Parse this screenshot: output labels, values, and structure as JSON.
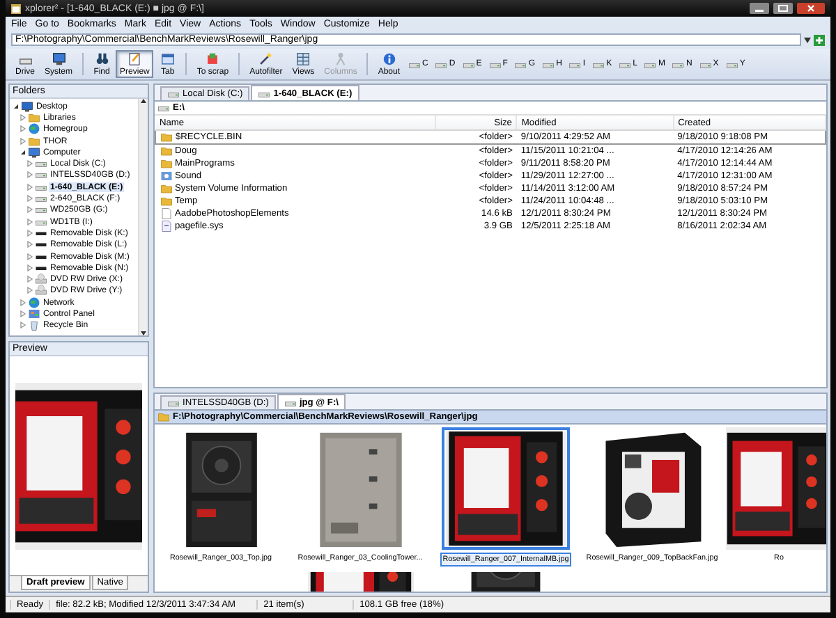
{
  "window": {
    "title": "xplorer² - [1-640_BLACK (E:) ■ jpg @ F:\\]"
  },
  "menu": [
    "File",
    "Go to",
    "Bookmarks",
    "Mark",
    "Edit",
    "View",
    "Actions",
    "Tools",
    "Window",
    "Customize",
    "Help"
  ],
  "address": {
    "value": "F:\\Photography\\Commercial\\BenchMarkReviews\\Rosewill_Ranger\\jpg"
  },
  "toolbar": [
    {
      "label": "Drive",
      "kind": "drive",
      "selected": false,
      "disabled": false
    },
    {
      "label": "System",
      "kind": "computer",
      "selected": false,
      "disabled": false
    },
    {
      "label": "Find",
      "kind": "find",
      "selected": false,
      "disabled": false
    },
    {
      "label": "Preview",
      "kind": "preview",
      "selected": true,
      "disabled": false
    },
    {
      "label": "Tab",
      "kind": "tab",
      "selected": false,
      "disabled": false
    },
    {
      "label": "To scrap",
      "kind": "scrap",
      "selected": false,
      "disabled": false
    },
    {
      "label": "Autofilter",
      "kind": "filter",
      "selected": false,
      "disabled": false
    },
    {
      "label": "Views",
      "kind": "views",
      "selected": false,
      "disabled": false
    },
    {
      "label": "Columns",
      "kind": "columns",
      "selected": false,
      "disabled": true
    },
    {
      "label": "About",
      "kind": "about",
      "selected": false,
      "disabled": false
    }
  ],
  "drives": [
    "C",
    "D",
    "E",
    "F",
    "G",
    "H",
    "I",
    "K",
    "L",
    "M",
    "N",
    "X",
    "Y"
  ],
  "folders": {
    "title": "Folders",
    "tree": [
      {
        "label": "Desktop",
        "kind": "desktop",
        "expanded": true,
        "selected": false,
        "children": [
          {
            "label": "Libraries",
            "kind": "folder",
            "expanded": false,
            "selected": false
          },
          {
            "label": "Homegroup",
            "kind": "network",
            "expanded": false,
            "selected": false
          },
          {
            "label": "THOR",
            "kind": "folder",
            "expanded": false,
            "selected": false
          },
          {
            "label": "Computer",
            "kind": "computer",
            "expanded": true,
            "selected": false,
            "children": [
              {
                "label": "Local Disk (C:)",
                "kind": "drive",
                "expanded": false,
                "selected": false
              },
              {
                "label": "INTELSSD40GB (D:)",
                "kind": "drive",
                "expanded": false,
                "selected": false
              },
              {
                "label": "1-640_BLACK (E:)",
                "kind": "drive",
                "expanded": false,
                "selected": true
              },
              {
                "label": "2-640_BLACK (F:)",
                "kind": "drive",
                "expanded": false,
                "selected": false
              },
              {
                "label": "WD250GB (G:)",
                "kind": "drive",
                "expanded": false,
                "selected": false
              },
              {
                "label": "WD1TB (I:)",
                "kind": "drive",
                "expanded": false,
                "selected": false
              },
              {
                "label": "Removable Disk (K:)",
                "kind": "removable",
                "expanded": false,
                "selected": false
              },
              {
                "label": "Removable Disk (L:)",
                "kind": "removable",
                "expanded": false,
                "selected": false
              },
              {
                "label": "Removable Disk (M:)",
                "kind": "removable",
                "expanded": false,
                "selected": false
              },
              {
                "label": "Removable Disk (N:)",
                "kind": "removable",
                "expanded": false,
                "selected": false
              },
              {
                "label": "DVD RW Drive (X:)",
                "kind": "dvd",
                "expanded": false,
                "selected": false
              },
              {
                "label": "DVD RW Drive (Y:)",
                "kind": "dvd",
                "expanded": false,
                "selected": false
              }
            ]
          },
          {
            "label": "Network",
            "kind": "network",
            "expanded": false,
            "selected": false
          },
          {
            "label": "Control Panel",
            "kind": "panel",
            "expanded": false,
            "selected": false
          },
          {
            "label": "Recycle Bin",
            "kind": "bin",
            "expanded": false,
            "selected": false
          }
        ]
      }
    ]
  },
  "preview": {
    "title": "Preview",
    "tabs": [
      {
        "label": "Draft preview",
        "selected": true
      },
      {
        "label": "Native",
        "selected": false
      }
    ]
  },
  "top_pane": {
    "tabs": [
      {
        "label": "Local Disk (C:)",
        "selected": false
      },
      {
        "label": "1-640_BLACK (E:)",
        "selected": true
      }
    ],
    "path": "E:\\",
    "columns": [
      "Name",
      "Size",
      "Modified",
      "Created"
    ],
    "rows": [
      {
        "kind": "folder",
        "selected": true,
        "cells": [
          "$RECYCLE.BIN",
          "<folder>",
          "9/10/2011 4:29:52 AM",
          "9/18/2010 9:18:08 PM"
        ]
      },
      {
        "kind": "folder",
        "selected": false,
        "cells": [
          "Doug",
          "<folder>",
          "11/15/2011 10:21:04 ...",
          "4/17/2010 12:14:26 AM"
        ]
      },
      {
        "kind": "folder",
        "selected": false,
        "cells": [
          "MainPrograms",
          "<folder>",
          "9/11/2011 8:58:20 PM",
          "4/17/2010 12:14:44 AM"
        ]
      },
      {
        "kind": "media",
        "selected": false,
        "cells": [
          "Sound",
          "<folder>",
          "11/29/2011 12:27:00 ...",
          "4/17/2010 12:31:00 AM"
        ]
      },
      {
        "kind": "folder",
        "selected": false,
        "cells": [
          "System Volume Information",
          "<folder>",
          "11/14/2011 3:12:00 AM",
          "9/18/2010 8:57:24 PM"
        ]
      },
      {
        "kind": "folder",
        "selected": false,
        "cells": [
          "Temp",
          "<folder>",
          "11/24/2011 10:04:48 ...",
          "9/18/2010 5:03:10 PM"
        ]
      },
      {
        "kind": "file",
        "selected": false,
        "cells": [
          "AadobePhotoshopElements",
          "14.6 kB",
          "12/1/2011 8:30:24 PM",
          "12/1/2011 8:30:24 PM"
        ]
      },
      {
        "kind": "system",
        "selected": false,
        "cells": [
          "pagefile.sys",
          "3.9 GB",
          "12/5/2011 2:25:18 AM",
          "8/16/2011 2:02:34 AM"
        ]
      }
    ]
  },
  "bottom_pane": {
    "tabs": [
      {
        "label": "INTELSSD40GB (D:)",
        "selected": false
      },
      {
        "label": "jpg @ F:\\",
        "selected": true
      }
    ],
    "path": "F:\\Photography\\Commercial\\BenchMarkReviews\\Rosewill_Ranger\\jpg",
    "thumbnails": [
      {
        "caption": "Rosewill_Ranger_003_Top.jpg",
        "selected": false
      },
      {
        "caption": "Rosewill_Ranger_03_CoolingTower...",
        "selected": false
      },
      {
        "caption": "Rosewill_Ranger_007_InternalMB.jpg",
        "selected": true
      },
      {
        "caption": "Rosewill_Ranger_009_TopBackFan.jpg",
        "selected": false
      },
      {
        "caption": "Ro",
        "selected": false
      }
    ]
  },
  "status_bar": {
    "state": "Ready",
    "file_info": "file: 82.2 kB; Modified 12/3/2011 3:47:34 AM",
    "items": "21 item(s)",
    "free": "108.1 GB free (18%)"
  }
}
